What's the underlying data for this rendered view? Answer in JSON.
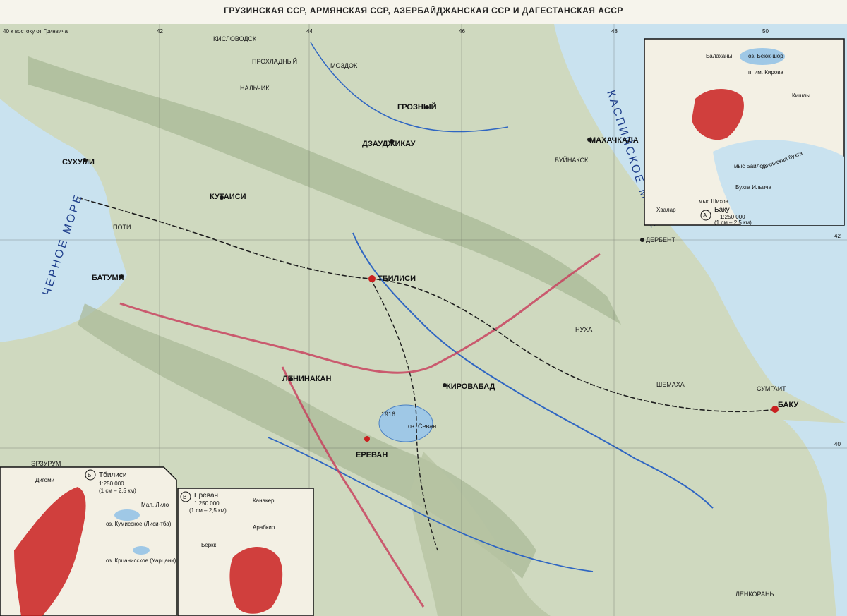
{
  "title": "ГРУЗИНСКАЯ ССР, АРМЯНСКАЯ ССР, АЗЕРБАЙДЖАНСКАЯ ССР И ДАГЕСТАНСКАЯ АССР",
  "top_left_note": "40 к востоку от Гринвича",
  "lon_labels": [
    "42",
    "44",
    "46",
    "48",
    "50"
  ],
  "lat_labels": [
    "42",
    "40"
  ],
  "seas": {
    "black_sea": "ЧЕРНОЕ МОРЕ",
    "caspian_sea": "КАСПИЙСКОЕ МОРЕ"
  },
  "cities": {
    "tbilisi": "ТБИЛИСИ",
    "baku": "БАКУ",
    "yerevan": "ЕРЕВАН",
    "kirovabad": "КИРОВАБАД",
    "leninakan": "ЛЕНИНАКАН",
    "kutaisi": "КУТАИСИ",
    "batumi": "БАТУМИ",
    "sukhumi": "СУХУМИ",
    "grozny": "ГРОЗНЫЙ",
    "makhachkala": "МАХАЧКАЛА",
    "dzaudzhikau": "ДЗАУДЖИКАУ",
    "derbent": "ДЕРБЕНТ",
    "nalchik": "НАЛЬЧИК",
    "kislovodsk": "КИСЛОВОДСК",
    "poti": "ПОТИ",
    "erzurum": "ЭРЗУРУМ",
    "buinaksk": "БУЙНАКСК",
    "lenkoran": "ЛЕНКОРАНЬ",
    "sumgait": "СУМГАИТ",
    "shemakha": "ШЕМАХА",
    "nukha": "НУХА",
    "mozdok": "МОЗДОК",
    "prokhladny": "ПРОХЛАДНЫЙ"
  },
  "lakes": {
    "sevan": "оз. Севан",
    "sevan_level": "1916"
  },
  "inset_baku": {
    "letter": "А",
    "title": "Баку",
    "scale": "1:250 000",
    "scale_note": "(1 см – 2,5 км)",
    "bay": "Бакинская бухта",
    "lake": "оз. Беюк-шор",
    "places": [
      "Балаханы",
      "п. им. Кирова",
      "Кишлы",
      "мыс Баилов",
      "Бухта Ильича",
      "Хвалар",
      "мыс Шихов"
    ]
  },
  "inset_tbilisi": {
    "letter": "Б",
    "title": "Тбилиси",
    "scale": "1:250 000",
    "scale_note": "(1 см – 2,5 км)",
    "lakes": [
      "оз. Кумисское (Лиси-тба)",
      "оз. Крцанисское (Уарцани)"
    ],
    "places": [
      "Дигоми",
      "Мал. Лило"
    ]
  },
  "inset_yerevan": {
    "letter": "В",
    "title": "Ереван",
    "scale": "1:250 000",
    "scale_note": "(1 см – 2,5 км)",
    "places": [
      "Канакер",
      "Арабкир",
      "Беркк"
    ]
  },
  "colors": {
    "sea": "#c9e2ef",
    "land": "#cfd9bf",
    "mountain": "#a8b896",
    "border_red": "#c83a5a",
    "river": "#2f66c2",
    "rail": "#1e1e1e",
    "city_red": "#c92020"
  }
}
